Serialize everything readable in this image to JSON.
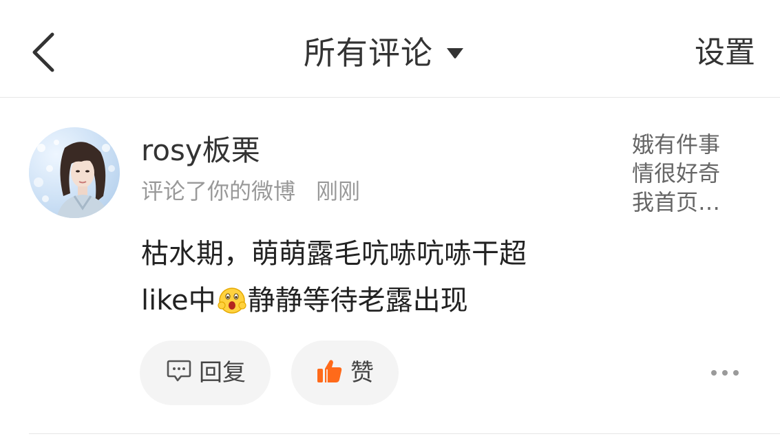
{
  "header": {
    "title": "所有评论",
    "settings_label": "设置"
  },
  "comment": {
    "username": "rosy板栗",
    "action": "评论了你的微博",
    "time": "刚刚",
    "text_line1": "枯水期，萌萌露毛吭哧吭哧干超",
    "text_line2_before": "like中",
    "text_line2_after": "静静等待老露出现",
    "original_post_preview": "娥有件事情很好奇我首页…",
    "reply_label": "回复",
    "like_label": "赞"
  },
  "icons": {
    "back": "chevron-left-icon",
    "title_dropdown": "caret-down-icon",
    "reply": "comment-bubble-icon",
    "like": "thumbs-up-icon",
    "emoji": "surprised-face-emoji",
    "more": "more-dots-icon"
  },
  "colors": {
    "text": "#333333",
    "secondary_text": "#999999",
    "pill_bg": "#f4f4f4",
    "like_orange": "#ff6a1a"
  }
}
